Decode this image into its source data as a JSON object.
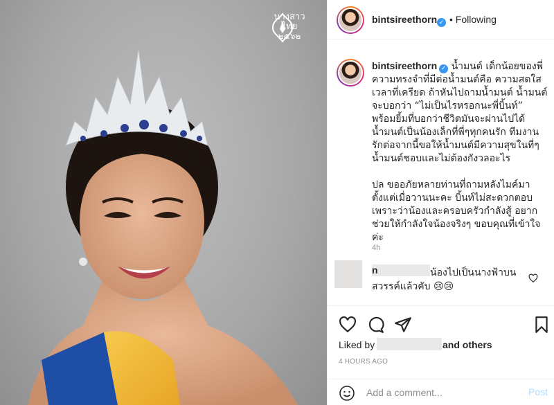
{
  "photo": {
    "watermark_line1": "นางสาวไทย",
    "watermark_line2": "๒๕๖๒"
  },
  "header": {
    "username": "bintsireethorn",
    "separator": "•",
    "follow_status": "Following"
  },
  "caption": {
    "username": "bintsireethorn",
    "paragraph1": "น้ำมนต์ เด็กน้อยของพี่ ความทรงจำที่มีต่อน้ำมนต์คือ ความสดใส เวลาที่เครียด ถ้าหันไปถามน้ำมนต์ น้ำมนต์จะบอกว่า “ไม่เป็นไรหรอกนะพี่บิ้นท์” พร้อมยิ้มที่บอกว่าชีวิตมันจะผ่านไปได้ น้ำมนต์เป็นน้องเล็กที่พี่ๆทุกคนรัก ทีมงานรักต่อจากนี้ขอให้น้ำมนต์มีความสุขในที่ๆน้ำมนต์ชอบและไม่ต้องกังวลอะไร",
    "paragraph2": "ปล ขออภัยหลายท่านที่ถามหลังไมค์มาตั้งแต่เมื่อวานนะคะ บิ้นท์ไม่สะดวกตอบ เพราะว่าน้องและครอบครัวกำลังสู้ อยากช่วยให้กำลังใจน้องจริงๆ ขอบคุณที่เข้าใจค่ะ",
    "time": "4h"
  },
  "comment": {
    "username_visible": "n",
    "text": "น้องไปเป็นนางฟ้าบนสวรรค์แล้วคับ 😢😢"
  },
  "actions": {
    "liked_by_prefix": "Liked by",
    "and_others": "and others",
    "time_ago": "4 hours ago"
  },
  "add_comment": {
    "placeholder": "Add a comment...",
    "post_label": "Post"
  },
  "colors": {
    "accent_blue": "#3897f0",
    "post_disabled": "#b3dbff",
    "muted_text": "#8e8e8e",
    "border": "#efefef"
  },
  "icons": [
    "heart-icon",
    "comment-icon",
    "share-icon",
    "bookmark-icon",
    "smiley-icon",
    "verified-badge-icon"
  ]
}
